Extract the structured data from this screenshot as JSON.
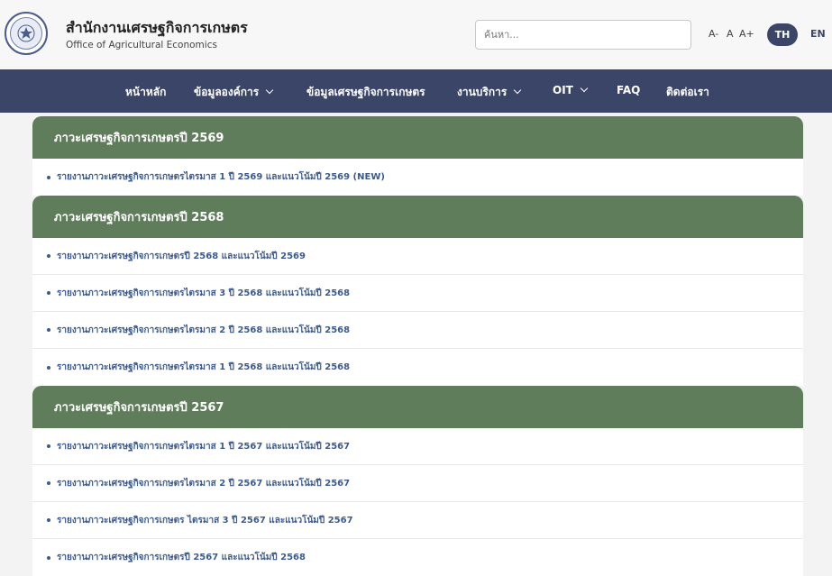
{
  "header": {
    "org_name_th": "สำนักงานเศรษฐกิจการเกษตร",
    "org_name_en": "Office of Agricultural Economics",
    "logo_icon": "oae-seal-icon",
    "search_placeholder": "ค้นหา...",
    "font_decrease": "A-",
    "font_normal": "A",
    "font_increase": "A+",
    "lang_th": "TH",
    "lang_en": "EN"
  },
  "nav": {
    "items": [
      {
        "label": "หน้าหลัก",
        "has_dropdown": false
      },
      {
        "label": "ข้อมูลองค์การ",
        "has_dropdown": true
      },
      {
        "label": "ข้อมูลเศรษฐกิจการเกษตร",
        "has_dropdown": false
      },
      {
        "label": "งานบริการ",
        "has_dropdown": true
      },
      {
        "label": "OIT",
        "has_dropdown": true
      },
      {
        "label": "FAQ",
        "has_dropdown": false
      },
      {
        "label": "ติดต่อเรา",
        "has_dropdown": false
      }
    ]
  },
  "sections": [
    {
      "title": "ภาวะเศรษฐกิจการเกษตรปี 2569",
      "items": [
        "รายงานภาวะเศรษฐกิจการเกษตรไตรมาส 1 ปี 2569 และแนวโน้มปี 2569 (NEW)"
      ]
    },
    {
      "title": "ภาวะเศรษฐกิจการเกษตรปี 2568",
      "items": [
        "รายงานภาวะเศรษฐกิจการเกษตรปี 2568 และแนวโน้มปี 2569",
        "รายงานภาวะเศรษฐกิจการเกษตรไตรมาส 3 ปี 2568 และแนวโน้มปี 2568",
        "รายงานภาวะเศรษฐกิจการเกษตรไตรมาส 2 ปี 2568 และแนวโน้มปี 2568",
        "รายงานภาวะเศรษฐกิจการเกษตรไตรมาส 1 ปี 2568 และแนวโน้มปี 2568"
      ]
    },
    {
      "title": "ภาวะเศรษฐกิจการเกษตรปี 2567",
      "items": [
        "รายงานภาวะเศรษฐกิจการเกษตรไตรมาส 1 ปี 2567 และแนวโน้มปี 2567",
        "รายงานภาวะเศรษฐกิจการเกษตรไตรมาส 2 ปี 2567 และแนวโน้มปี 2567",
        "รายงานภาวะเศรษฐกิจการเกษตร ไตรมาส 3 ปี 2567 และแนวโน้มปี 2567",
        "รายงานภาวะเศรษฐกิจการเกษตรปี 2567 และแนวโน้มปี 2568"
      ]
    }
  ],
  "colors": {
    "nav_bg": "#3b4568",
    "section_header_bg": "#607d5b",
    "link_text": "#3c5a8f"
  }
}
